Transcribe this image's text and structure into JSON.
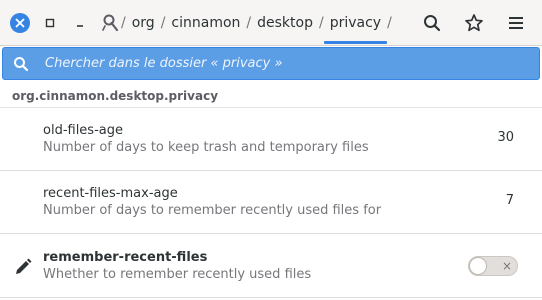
{
  "header": {
    "breadcrumbs": [
      {
        "label": "org"
      },
      {
        "label": "cinnamon"
      },
      {
        "label": "desktop"
      },
      {
        "label": "privacy"
      }
    ],
    "separator": "/",
    "icons": {
      "close": "close-icon",
      "maximize": "maximize-icon",
      "minimize": "minimize-icon",
      "path": "path-icon",
      "search": "search-icon",
      "bookmark": "star-icon",
      "menu": "hamburger-menu-icon"
    },
    "accent_color": "#3584e4"
  },
  "search": {
    "placeholder": "Chercher dans le dossier « privacy »"
  },
  "path_header": "org.cinnamon.desktop.privacy",
  "keys": [
    {
      "name": "old-files-age",
      "description": "Number of days to keep trash and temporary files",
      "value": "30"
    },
    {
      "name": "recent-files-max-age",
      "description": "Number of days to remember recently used files for",
      "value": "7"
    },
    {
      "name": "remember-recent-files",
      "description": "Whether to remember recently used files",
      "modified_icon": "pencil-icon",
      "switch_on": false,
      "switch_off_glyph": "×"
    }
  ]
}
